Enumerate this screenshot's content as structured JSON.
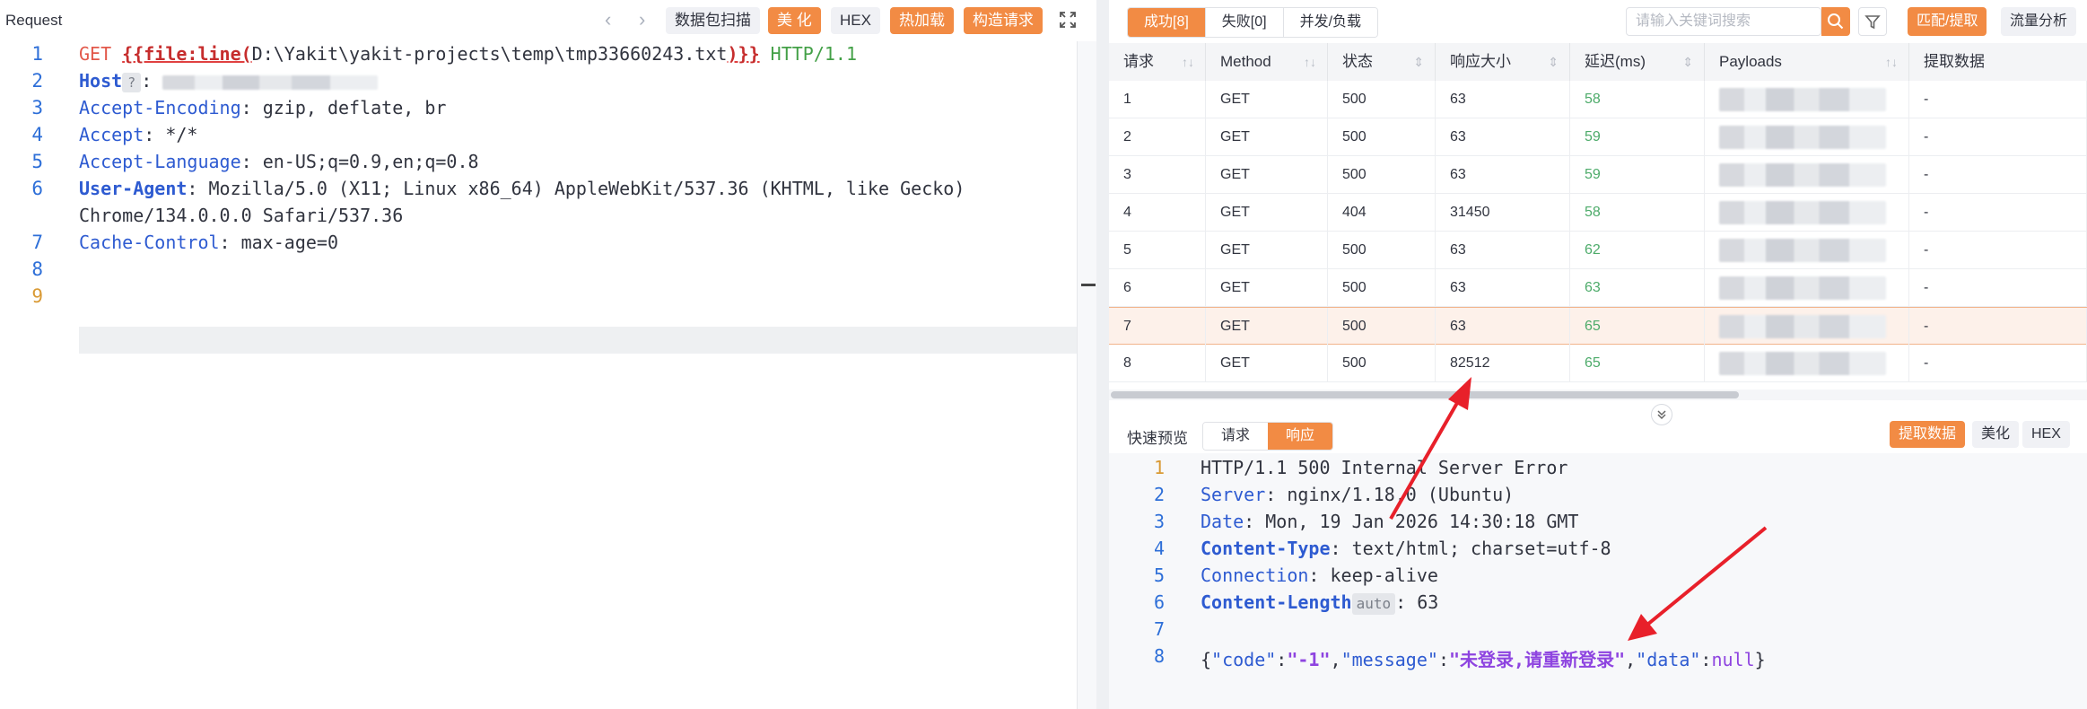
{
  "left": {
    "title": "Request",
    "toolbar": {
      "back_icon": "chevron-left-icon",
      "forward_icon": "chevron-right-icon",
      "scan": "数据包扫描",
      "beautify": "美 化",
      "hex": "HEX",
      "hotload": "热加载",
      "build": "构造请求",
      "expand_icon": "expand-icon"
    },
    "lines": [
      "1",
      "2",
      "3",
      "4",
      "5",
      "6",
      "",
      "7",
      "8",
      "9"
    ],
    "code": {
      "l1_method": "GET",
      "l1_tag_open": "{{file:line(",
      "l1_path": "D:\\Yakit\\yakit-projects\\temp\\tmp33660243.txt",
      "l1_tag_close": ")}}",
      "l1_proto": "HTTP/1.1",
      "l2_key": "Host",
      "l2_badge": "?",
      "l2_sep": ":",
      "l3_key": "Accept-Encoding",
      "l3_val": ": gzip, deflate, br",
      "l4_key": "Accept",
      "l4_val": ": */*",
      "l5_key": "Accept-Language",
      "l5_val": ": en-US;q=0.9,en;q=0.8",
      "l6_key": "User-Agent",
      "l6_val": ": Mozilla/5.0 (X11; Linux x86_64) AppleWebKit/537.36 (KHTML, like Gecko)",
      "l6b_val": "Chrome/134.0.0.0 Safari/537.36",
      "l7_key": "Cache-Control",
      "l7_val": ": max-age=0"
    }
  },
  "right": {
    "tabs": [
      "成功[8]",
      "失败[0]",
      "并发/负载"
    ],
    "search": {
      "placeholder": "请输入关键词搜索",
      "icon": "search-icon"
    },
    "filter_icon": "filter-icon",
    "match_button": "匹配/提取",
    "traffic_button": "流量分析",
    "table": {
      "headers": [
        "请求",
        "Method",
        "状态",
        "响应大小",
        "延迟(ms)",
        "Payloads",
        "提取数据"
      ],
      "rows": [
        {
          "id": "1",
          "method": "GET",
          "status": "500",
          "size": "63",
          "delay": "58",
          "extract": "-"
        },
        {
          "id": "2",
          "method": "GET",
          "status": "500",
          "size": "63",
          "delay": "59",
          "extract": "-"
        },
        {
          "id": "3",
          "method": "GET",
          "status": "500",
          "size": "63",
          "delay": "59",
          "extract": "-"
        },
        {
          "id": "4",
          "method": "GET",
          "status": "404",
          "size": "31450",
          "delay": "58",
          "extract": "-"
        },
        {
          "id": "5",
          "method": "GET",
          "status": "500",
          "size": "63",
          "delay": "62",
          "extract": "-"
        },
        {
          "id": "6",
          "method": "GET",
          "status": "500",
          "size": "63",
          "delay": "63",
          "extract": "-"
        },
        {
          "id": "7",
          "method": "GET",
          "status": "500",
          "size": "63",
          "delay": "65",
          "extract": "-"
        },
        {
          "id": "8",
          "method": "GET",
          "status": "500",
          "size": "82512",
          "delay": "65",
          "extract": "-"
        }
      ]
    },
    "preview": {
      "title": "快速预览",
      "tab_request": "请求",
      "tab_response": "响应",
      "extract_button": "提取数据",
      "beautify": "美化",
      "hex": "HEX",
      "collapse_icon": "chevrons-down-icon"
    },
    "response": {
      "lines": [
        "1",
        "2",
        "3",
        "4",
        "5",
        "6",
        "7",
        "8"
      ],
      "l1": "HTTP/1.1 500 Internal Server Error",
      "l2_key": "Server",
      "l2_val": ": nginx/1.18.0 (Ubuntu)",
      "l3_key": "Date",
      "l3_val": ": Mon, 19 Jan 2026 14:30:18 GMT",
      "l4_key": "Content-Type",
      "l4_val": ": text/html; charset=utf-8",
      "l5_key": "Connection",
      "l5_val": ": keep-alive",
      "l6_key": "Content-Length",
      "l6_badge": "auto",
      "l6_val": ": 63",
      "body": {
        "open": "{",
        "k1": "\"code\"",
        "v1": "\"-1\"",
        "k2": "\"message\"",
        "v2": "\"未登录,请重新登录\"",
        "k3": "\"data\"",
        "v3": "null",
        "close": "}",
        "colon": ":",
        "comma": ","
      }
    }
  },
  "colors": {
    "accent": "#f28b44",
    "key_blue": "#2e5bd1",
    "delay_green": "#4dab6a",
    "annotation_red": "#e8202a"
  }
}
